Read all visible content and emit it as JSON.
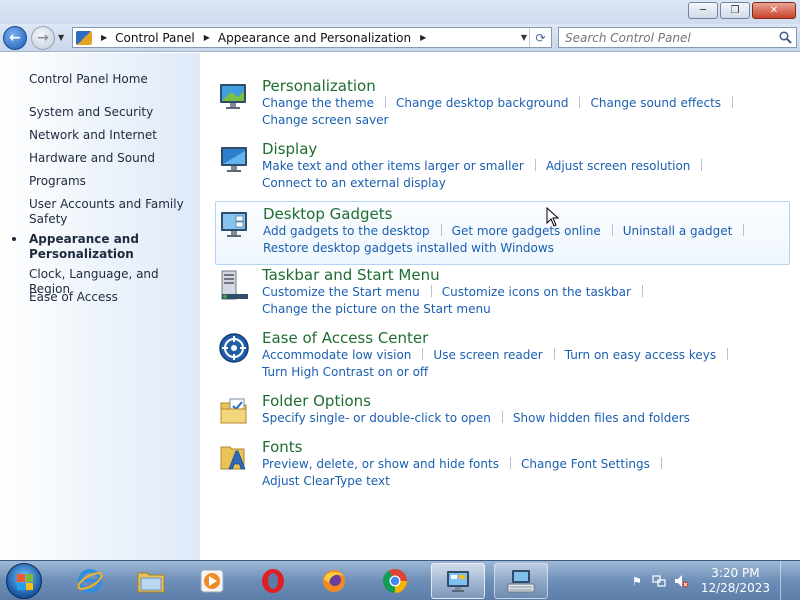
{
  "window": {
    "minimize_icon": "minimize-icon",
    "maximize_icon": "maximize-icon",
    "close_icon": "close-icon"
  },
  "address_bar": {
    "breadcrumbs": [
      "Control Panel",
      "Appearance and Personalization"
    ]
  },
  "search": {
    "placeholder": "Search Control Panel"
  },
  "sidebar": {
    "home": "Control Panel Home",
    "items": [
      {
        "label": "System and Security"
      },
      {
        "label": "Network and Internet"
      },
      {
        "label": "Hardware and Sound"
      },
      {
        "label": "Programs"
      },
      {
        "label": "User Accounts and Family Safety"
      },
      {
        "label": "Appearance and Personalization",
        "current": true
      },
      {
        "label": "Clock, Language, and Region"
      },
      {
        "label": "Ease of Access"
      }
    ]
  },
  "categories": [
    {
      "title": "Personalization",
      "icon": "personalization-icon",
      "links": [
        "Change the theme",
        "Change desktop background",
        "Change sound effects",
        "Change screen saver"
      ]
    },
    {
      "title": "Display",
      "icon": "display-icon",
      "links": [
        "Make text and other items larger or smaller",
        "Adjust screen resolution",
        "Connect to an external display"
      ]
    },
    {
      "title": "Desktop Gadgets",
      "icon": "desktop-gadgets-icon",
      "links": [
        "Add gadgets to the desktop",
        "Get more gadgets online",
        "Uninstall a gadget",
        "Restore desktop gadgets installed with Windows"
      ]
    },
    {
      "title": "Taskbar and Start Menu",
      "icon": "taskbar-icon",
      "links": [
        "Customize the Start menu",
        "Customize icons on the taskbar",
        "Change the picture on the Start menu"
      ]
    },
    {
      "title": "Ease of Access Center",
      "icon": "ease-of-access-icon",
      "links": [
        "Accommodate low vision",
        "Use screen reader",
        "Turn on easy access keys",
        "Turn High Contrast on or off"
      ]
    },
    {
      "title": "Folder Options",
      "icon": "folder-options-icon",
      "links": [
        "Specify single- or double-click to open",
        "Show hidden files and folders"
      ]
    },
    {
      "title": "Fonts",
      "icon": "fonts-icon",
      "links": [
        "Preview, delete, or show and hide fonts",
        "Change Font Settings",
        "Adjust ClearType text"
      ]
    }
  ],
  "taskbar": {
    "apps": [
      "internet-explorer-icon",
      "file-explorer-icon",
      "media-player-icon",
      "opera-icon",
      "firefox-icon",
      "chrome-icon",
      "control-panel-icon",
      "keyboard-app-icon"
    ],
    "clock": {
      "time": "3:20 PM",
      "date": "12/28/2023"
    }
  },
  "colors": {
    "link": "#1a5fb0",
    "category_title": "#1f6d31",
    "taskbar": "#6e8fb8"
  }
}
